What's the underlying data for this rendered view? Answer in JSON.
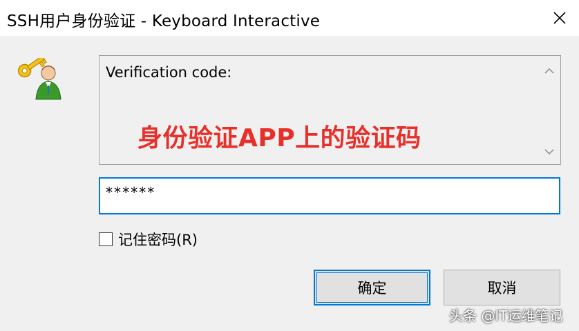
{
  "window": {
    "title": "SSH用户身份验证 - Keyboard Interactive"
  },
  "icons": {
    "close": "close-icon",
    "logo": "user-key-icon",
    "scroll_up": "chevron-up-icon",
    "scroll_down": "chevron-down-icon"
  },
  "prompt": {
    "label": "Verification code:",
    "annotation": "身份验证APP上的验证码"
  },
  "response": {
    "value": "******"
  },
  "remember": {
    "label": "记住密码(R)",
    "checked": false
  },
  "buttons": {
    "ok": "确定",
    "cancel": "取消"
  },
  "watermark": {
    "text": "头条 @IT运维笔记"
  },
  "colors": {
    "accent": "#0078d7",
    "annotation": "#e8302a",
    "background": "#f0f0f0"
  }
}
